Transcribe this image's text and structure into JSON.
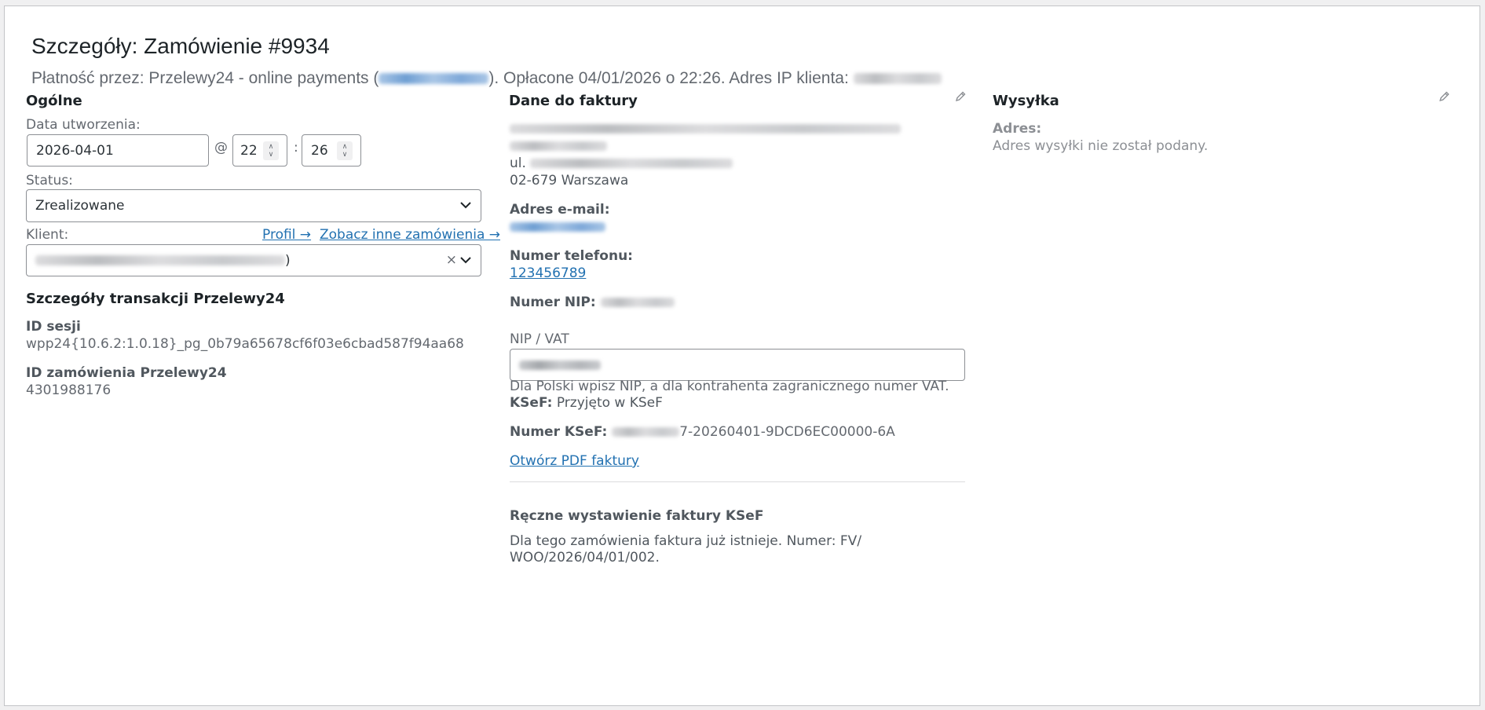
{
  "header": {
    "title": "Szczegóły: Zamówienie #9934",
    "payment_prefix": "Płatność przez: Przelewy24 - online payments (",
    "payment_suffix": "). Opłacone 04/01/2026 o 22:26. Adres IP klienta: "
  },
  "general": {
    "title": "Ogólne",
    "date_label": "Data utworzenia:",
    "date_value": "2026-04-01",
    "at_sign": "@",
    "hour": "22",
    "colon": ":",
    "minute": "26",
    "status_label": "Status:",
    "status_value": "Zrealizowane",
    "client_label": "Klient:",
    "profile_link": "Profil →",
    "other_orders_link": "Zobacz inne zamówienia →",
    "client_value_suffix": ")",
    "clear_symbol": "×"
  },
  "transaction": {
    "title": "Szczegóły transakcji Przelewy24",
    "session_label": "ID sesji",
    "session_value": "wpp24{10.6.2:1.0.18}_pg_0b79a65678cf6f03e6cbad587f94aa68",
    "order_id_label": "ID zamówienia Przelewy24",
    "order_id_value": "4301988176"
  },
  "billing": {
    "title": "Dane do faktury",
    "street_prefix": "ul. ",
    "city": "02-679 Warszawa",
    "email_label": "Adres e-mail:",
    "phone_label": "Numer telefonu:",
    "phone_value": "123456789",
    "nip_label": "Numer NIP: ",
    "nip_vat_label": "NIP / VAT",
    "nip_hint": "Dla Polski wpisz NIP, a dla kontrahenta zagranicznego numer VAT.",
    "ksef_label": "KSeF:",
    "ksef_value": " Przyjęto w KSeF",
    "ksef_number_label": "Numer KSeF: ",
    "ksef_number_suffix": "7-20260401-9DCD6EC00000-6A",
    "pdf_link": "Otwórz PDF faktury",
    "manual_title": "Ręczne wystawienie faktury KSeF",
    "manual_text_line1": "Dla tego zamówienia faktura już istnieje. Numer: FV/",
    "manual_text_line2": "WOO/2026/04/01/002."
  },
  "shipping": {
    "title": "Wysyłka",
    "address_label": "Adres:",
    "address_value": "Adres wysyłki nie został podany."
  },
  "colors": {
    "link": "#2271b1",
    "text": "#50575e",
    "muted": "#646970",
    "border": "#8c8f94"
  }
}
